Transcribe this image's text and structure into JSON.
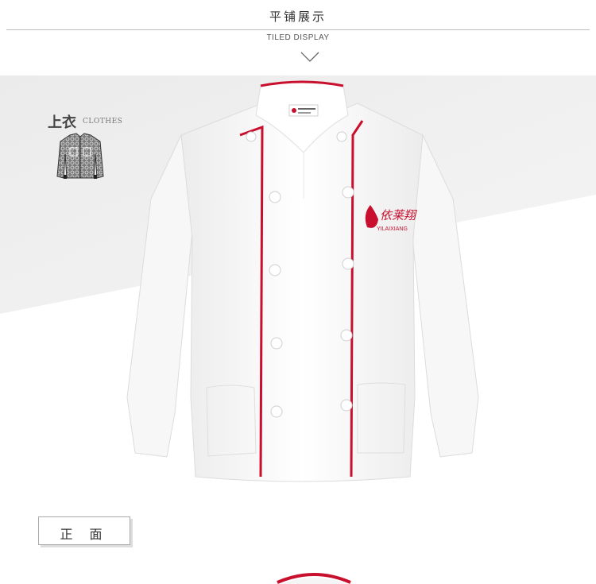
{
  "header": {
    "title": "平铺展示",
    "subtitle": "TILED DISPLAY"
  },
  "category": {
    "label": "上衣",
    "sublabel": "CLOTHES"
  },
  "product": {
    "logo_text_cn": "依莱翔",
    "logo_text_en": "YILAIXIANG",
    "view_label": "正 面"
  },
  "colors": {
    "piping": "#c8102e",
    "jacket": "#ffffff",
    "background_gray": "#efefef"
  }
}
